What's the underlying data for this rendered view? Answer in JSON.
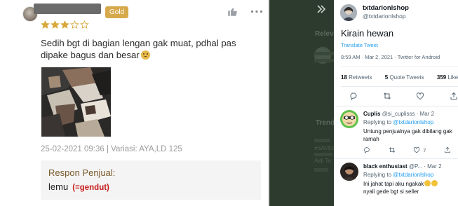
{
  "review": {
    "badge": "Gold",
    "rating": 3,
    "rating_max": 5,
    "text": "Sedih bgt di bagian lengan gak muat, pdhal pas dipake bagus dan besar",
    "meta": "25-02-2021 09:36 | Variasi: AYA,LD 125",
    "seller": {
      "title": "Respon Penjual:",
      "reply": "lemu",
      "note": "(=gendut)"
    },
    "colors": {
      "badge": "#d6a94a",
      "star": "#d7a83b",
      "seller_title": "#7a5a2c",
      "note": "#c81a1a"
    }
  },
  "background": {
    "relevant_label": "Releva",
    "trends_label": "Trend",
    "trend_1": "#SAVEA",
    "trend_2": "Aidi Ta"
  },
  "tweet": {
    "name": "txtdarionlshop",
    "handle": "@txtdarionlshop",
    "text": "Kirain hewan",
    "translate": "Translate Tweet",
    "time": "8:59 AM · Mar 2, 2021 · Twitter for Android",
    "retweets": "18",
    "retweets_label": "Retweets",
    "quotes": "5",
    "quotes_label": "Quote Tweets",
    "likes": "359",
    "likes_label": "Likes"
  },
  "replies": [
    {
      "name": "Cuplis",
      "handle": "@si_cuplisss",
      "date": "· Mar 2",
      "replying_label": "Replying to",
      "replying_to": "@txtdarionlshop",
      "text": "Untung penjualnya gak dibilang gak ramah",
      "likes": "7"
    },
    {
      "name": "black enthusiast",
      "handle": "@P...",
      "date": "· Mar 2",
      "replying_label": "Replying to",
      "replying_to": "@txtdarionlshop",
      "text": "Ini jahat tapi aku ngakak",
      "text_2": "nyali gede bgt si seller"
    }
  ],
  "icons": [
    "thumbs-up-icon",
    "more-icon",
    "star-icon",
    "chevron-double-right-icon",
    "reply-icon",
    "retweet-icon",
    "like-icon",
    "share-icon"
  ]
}
